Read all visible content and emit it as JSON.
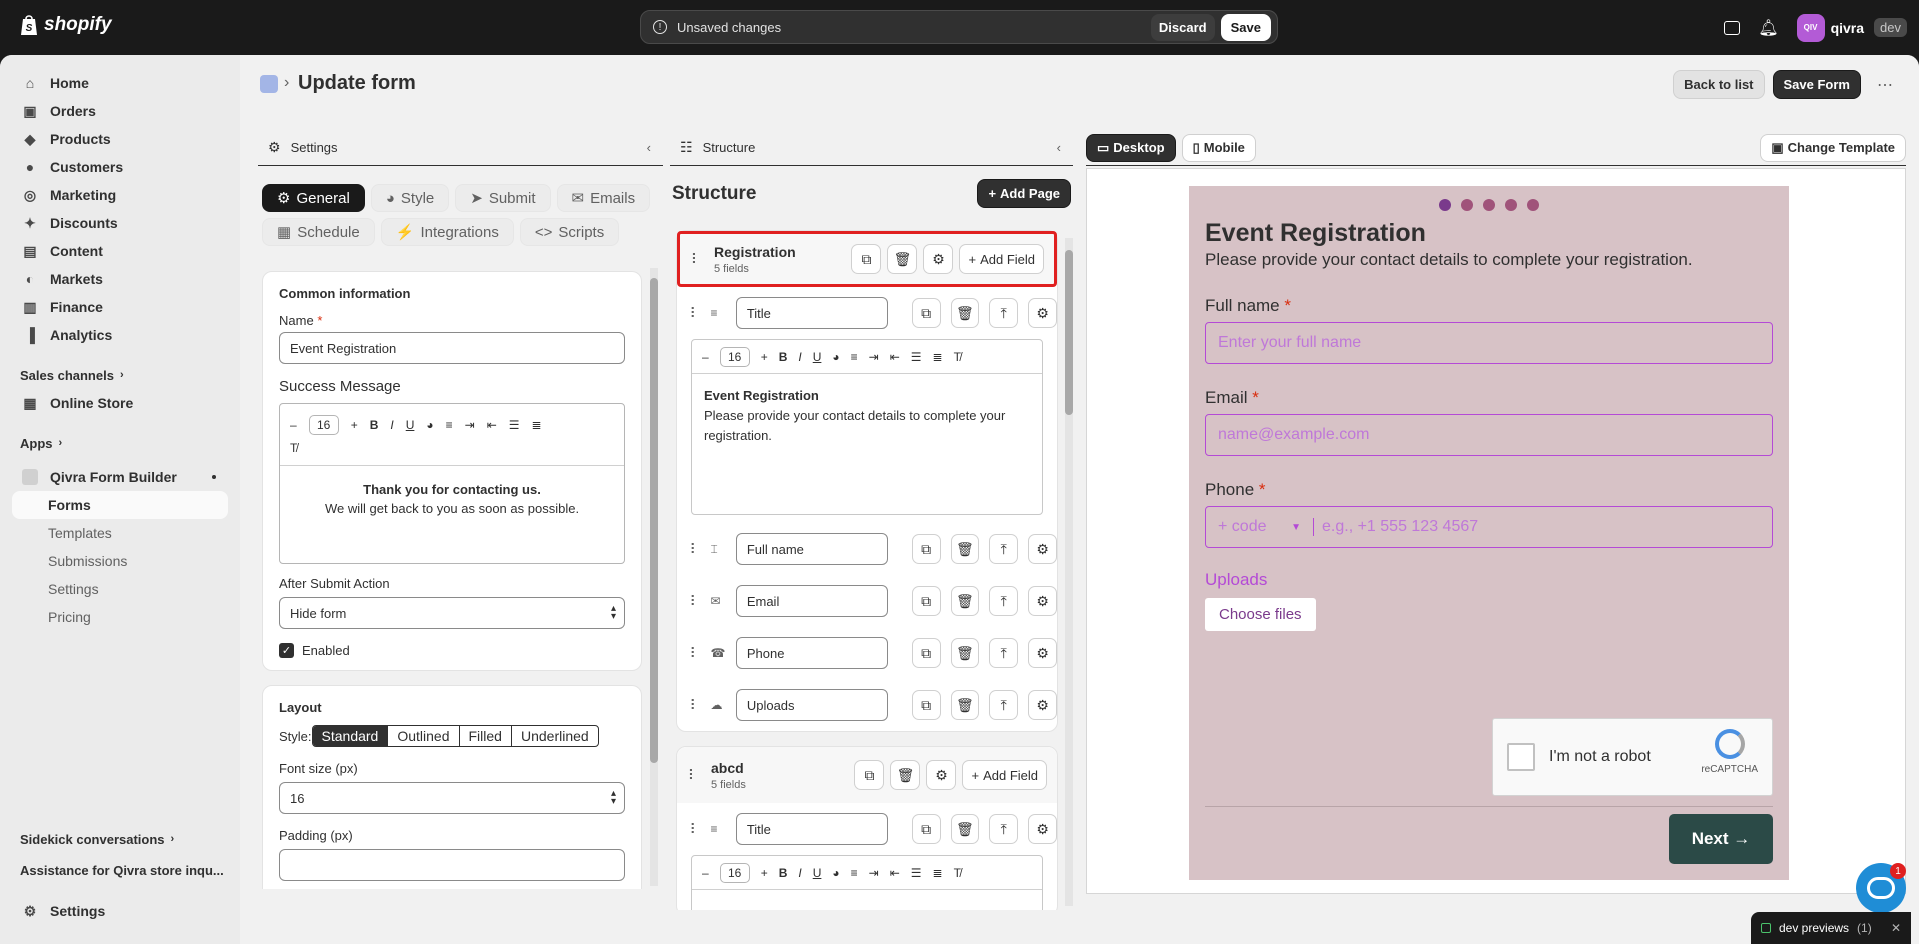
{
  "topbar": {
    "brand": "shopify",
    "unsaved_message": "Unsaved changes",
    "discard_label": "Discard",
    "save_label": "Save",
    "avatar_initials": "QIV",
    "store_name": "qivra",
    "store_badge": "dev"
  },
  "sidebar": {
    "items": [
      {
        "label": "Home",
        "icon": "home-icon"
      },
      {
        "label": "Orders",
        "icon": "orders-icon"
      },
      {
        "label": "Products",
        "icon": "tag-icon"
      },
      {
        "label": "Customers",
        "icon": "person-icon"
      },
      {
        "label": "Marketing",
        "icon": "target-icon"
      },
      {
        "label": "Discounts",
        "icon": "discount-icon"
      },
      {
        "label": "Content",
        "icon": "content-icon"
      },
      {
        "label": "Markets",
        "icon": "globe-icon"
      },
      {
        "label": "Finance",
        "icon": "bank-icon"
      },
      {
        "label": "Analytics",
        "icon": "chart-icon"
      }
    ],
    "sales_channels_label": "Sales channels",
    "online_store_label": "Online Store",
    "apps_label": "Apps",
    "app_name": "Qivra Form Builder",
    "app_subitems": [
      "Forms",
      "Templates",
      "Submissions",
      "Settings",
      "Pricing"
    ],
    "sidekick_label": "Sidekick conversations",
    "sidekick_item": "Assistance for Qivra store inqu...",
    "settings_label": "Settings"
  },
  "header": {
    "title": "Update form",
    "back_label": "Back to list",
    "save_form_label": "Save Form",
    "more_label": "⋯"
  },
  "settings_panel": {
    "title": "Settings",
    "tabs": [
      {
        "label": "General",
        "icon": "gear-icon"
      },
      {
        "label": "Style",
        "icon": "palette-icon"
      },
      {
        "label": "Submit",
        "icon": "send-icon"
      },
      {
        "label": "Emails",
        "icon": "mail-icon"
      },
      {
        "label": "Schedule",
        "icon": "calendar-icon"
      },
      {
        "label": "Integrations",
        "icon": "plug-icon"
      },
      {
        "label": "Scripts",
        "icon": "code-icon"
      }
    ],
    "common_info_title": "Common information",
    "name_label": "Name",
    "required_mark": "*",
    "name_value": "Event Registration",
    "success_label": "Success Message",
    "font_size_value": "16",
    "success_line1": "Thank you for contacting us.",
    "success_line2": "We will get back to you as soon as possible.",
    "after_submit_label": "After Submit Action",
    "after_submit_value": "Hide form",
    "enabled_label": "Enabled",
    "layout_title": "Layout",
    "style_label": "Style:",
    "style_options": [
      "Standard",
      "Outlined",
      "Filled",
      "Underlined"
    ],
    "font_size_label": "Font size (px)",
    "font_size_px": "16",
    "padding_label": "Padding (px)"
  },
  "structure_panel": {
    "title": "Structure",
    "heading": "Structure",
    "add_page_label": "Add Page",
    "pages": [
      {
        "name": "Registration",
        "count": "5 fields",
        "add_field_label": "Add Field",
        "fields": [
          "Title",
          "Full name",
          "Email",
          "Phone",
          "Uploads"
        ],
        "title_text": "Event Registration",
        "title_desc": "Please provide your contact details to complete your registration.",
        "font_size": "16"
      },
      {
        "name": "abcd",
        "count": "5 fields",
        "add_field_label": "Add Field",
        "fields": [
          "Title"
        ],
        "font_size": "16"
      }
    ]
  },
  "preview_panel": {
    "desktop_label": "Desktop",
    "mobile_label": "Mobile",
    "change_template_label": "Change Template",
    "form_title": "Event Registration",
    "form_desc": "Please provide your contact details to complete your registration.",
    "full_name_label": "Full name",
    "full_name_placeholder": "Enter your full name",
    "email_label": "Email",
    "email_placeholder": "name@example.com",
    "phone_label": "Phone",
    "phone_code": "+ code",
    "phone_placeholder": "e.g., +1 555 123 4567",
    "uploads_label": "Uploads",
    "choose_files_label": "Choose files",
    "captcha_label": "I'm not a robot",
    "captcha_brand": "reCAPTCHA",
    "next_label": "Next →",
    "chat_badge": "1"
  },
  "dev_preview": {
    "label": "dev previews",
    "count": "(1)"
  },
  "colors": {
    "accent_purple": "#b44ad6",
    "form_background": "#d7c2c6",
    "next_button": "#2b4a47",
    "highlight_red": "#e02020"
  }
}
